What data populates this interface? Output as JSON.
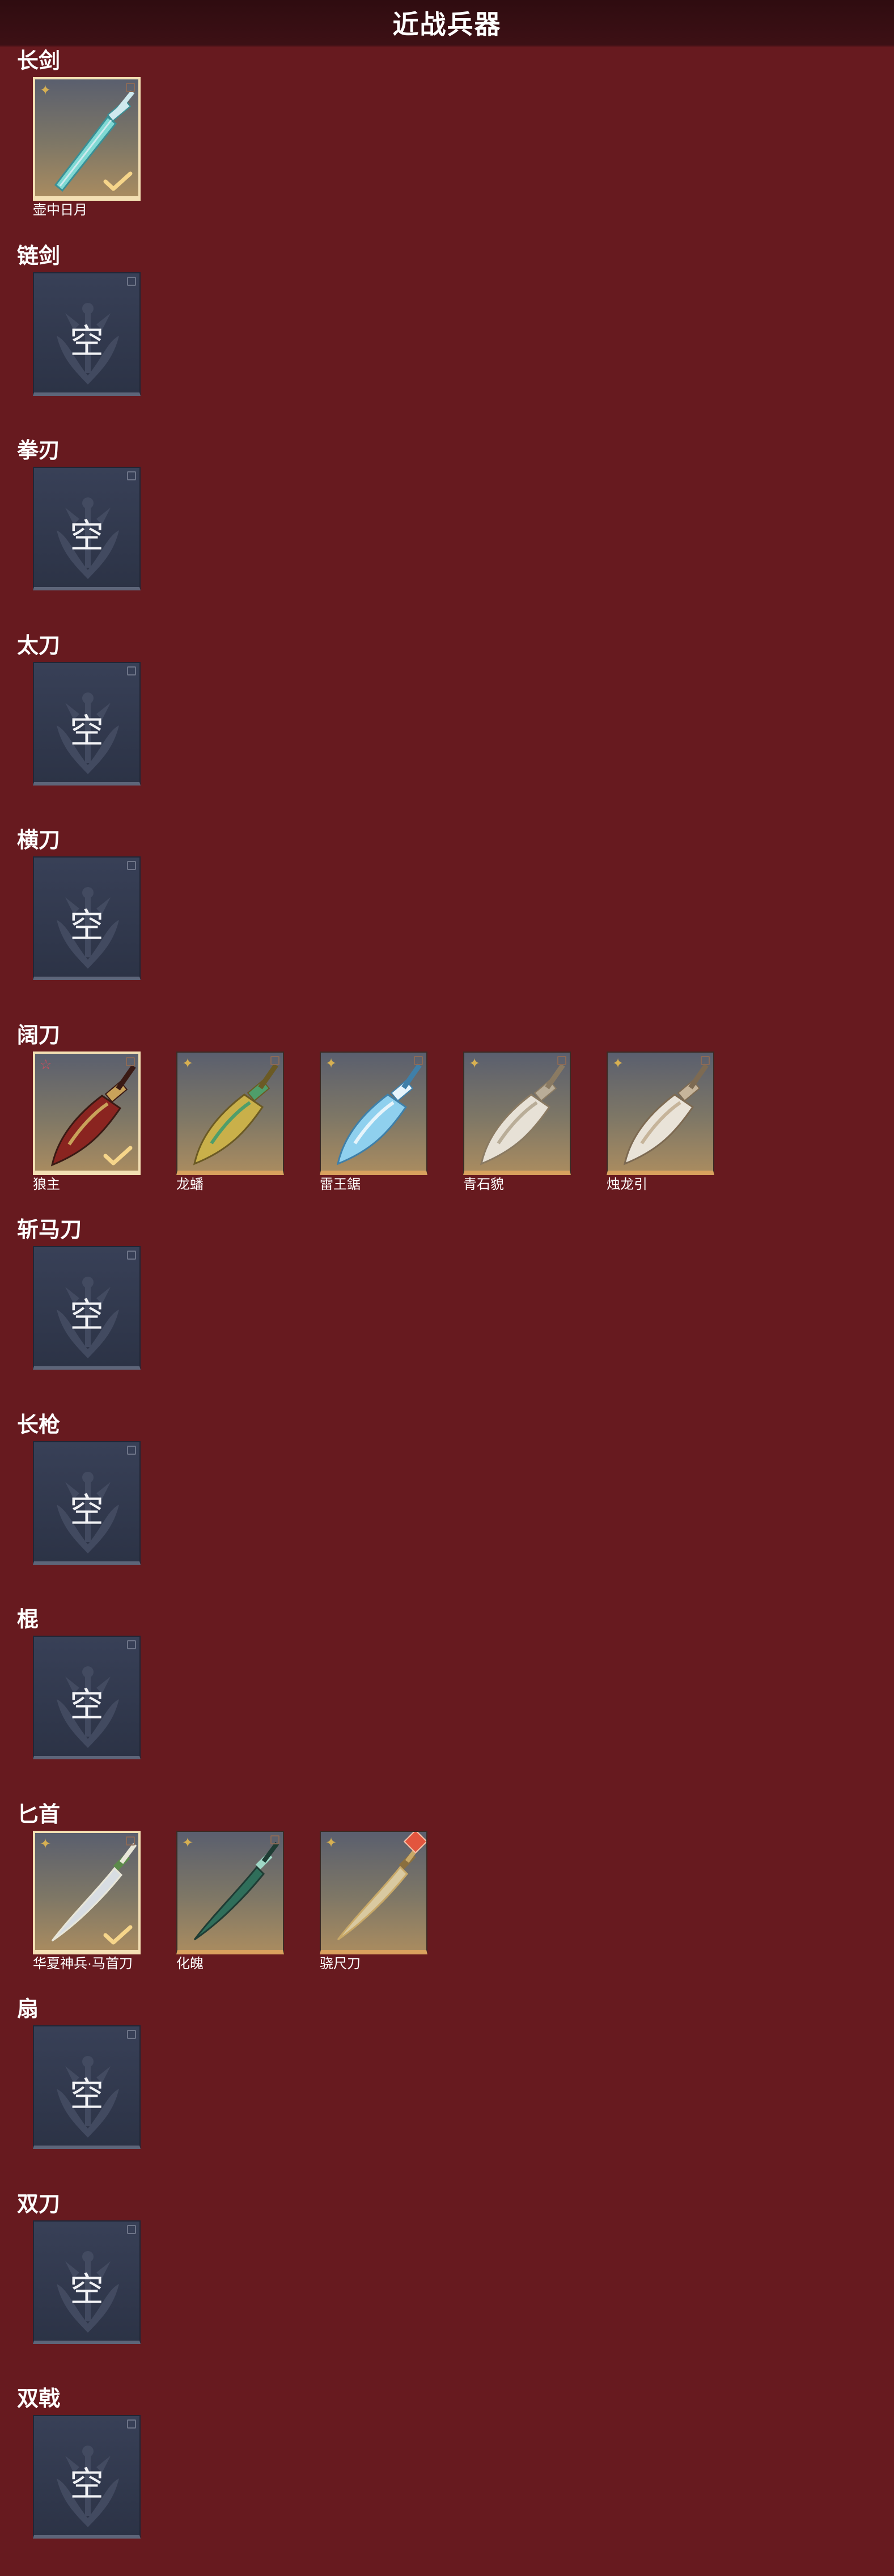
{
  "header": {
    "title": "近战兵器"
  },
  "empty_label": "空",
  "colors": {
    "background": "#671a1f",
    "header": "#2f0c10",
    "empty_card": "#343b50",
    "gold_bar": "#d9a15e",
    "selected_border": "#f3dfb3"
  },
  "categories": [
    {
      "name": "长剑",
      "items": [
        {
          "name": "壶中日月",
          "rarity": "gold-star-icon",
          "selected": true,
          "weapon": "long-sword"
        }
      ]
    },
    {
      "name": "链剑",
      "items": []
    },
    {
      "name": "拳刃",
      "items": []
    },
    {
      "name": "太刀",
      "items": []
    },
    {
      "name": "横刀",
      "items": []
    },
    {
      "name": "阔刀",
      "items": [
        {
          "name": "狼主",
          "rarity": "red-star-icon",
          "selected": true,
          "weapon": "broad-blade-red"
        },
        {
          "name": "龙蟠",
          "rarity": "gold-star-icon",
          "selected": false,
          "weapon": "broad-blade-gold"
        },
        {
          "name": "雷王鋸",
          "rarity": "gold-star-icon",
          "selected": false,
          "weapon": "broad-blade-ice"
        },
        {
          "name": "青石貌",
          "rarity": "gold-star-icon",
          "selected": false,
          "weapon": "broad-blade-stone"
        },
        {
          "name": "烛龙引",
          "rarity": "gold-star-icon",
          "selected": false,
          "weapon": "broad-blade-bone"
        }
      ]
    },
    {
      "name": "斩马刀",
      "items": []
    },
    {
      "name": "长枪",
      "items": []
    },
    {
      "name": "棍",
      "items": []
    },
    {
      "name": "匕首",
      "items": [
        {
          "name": "华夏神兵·马首刀",
          "rarity": "gold-star-icon",
          "selected": true,
          "weapon": "dagger-steel"
        },
        {
          "name": "化魄",
          "rarity": "gold-star-icon",
          "selected": false,
          "weapon": "dagger-jade"
        },
        {
          "name": "骁尺刀",
          "rarity": "gold-star-icon",
          "selected": false,
          "weapon": "dagger-gold",
          "badge": "red-diamond-icon"
        }
      ]
    },
    {
      "name": "扇",
      "items": []
    },
    {
      "name": "双刀",
      "items": []
    },
    {
      "name": "双戟",
      "items": []
    }
  ]
}
